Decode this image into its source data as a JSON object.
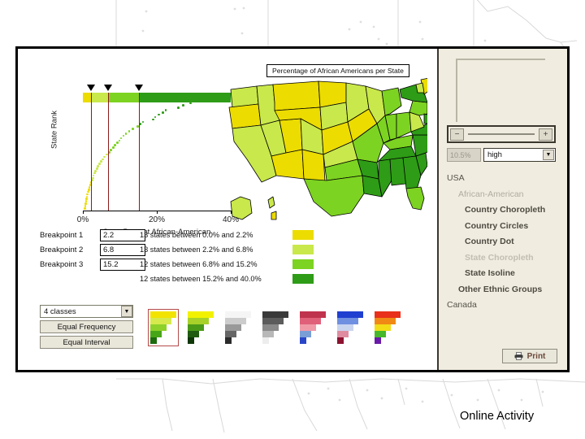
{
  "slide": {
    "caption": "Online Activity"
  },
  "chart_panel": {
    "yaxis_title": "State Rank",
    "xaxis_title": "State Percent African-American",
    "xticks": [
      "0%",
      "20%",
      "40%"
    ],
    "map_title": "Percentage of African Americans per State"
  },
  "chart_data": {
    "type": "scatter",
    "title": "Percentage of African Americans per State",
    "xlabel": "State Percent African-American",
    "ylabel": "State Rank",
    "xlim": [
      0,
      40
    ],
    "ylim": [
      50,
      0
    ],
    "xticks": [
      0,
      20,
      40
    ],
    "xtick_labels": [
      "0%",
      "20%",
      "40%"
    ],
    "grid": false,
    "legend_position": "right",
    "breakpoints": [
      2.2,
      6.8,
      15.2
    ],
    "class_colors": [
      "#ecdc00",
      "#c9e84b",
      "#7dd321",
      "#2e9c16"
    ],
    "class_counts": [
      13,
      13,
      12,
      12
    ],
    "class_ranges": [
      [
        0.0,
        2.2
      ],
      [
        2.2,
        6.8
      ],
      [
        6.8,
        15.2
      ],
      [
        15.2,
        40.0
      ]
    ],
    "points": [
      {
        "x": 36.8,
        "y": 1
      },
      {
        "x": 32.2,
        "y": 2
      },
      {
        "x": 31.1,
        "y": 3
      },
      {
        "x": 29.9,
        "y": 4
      },
      {
        "x": 28.8,
        "y": 5
      },
      {
        "x": 26.8,
        "y": 6
      },
      {
        "x": 25.6,
        "y": 7
      },
      {
        "x": 22.1,
        "y": 8
      },
      {
        "x": 21.4,
        "y": 9
      },
      {
        "x": 20.2,
        "y": 10
      },
      {
        "x": 19.3,
        "y": 11
      },
      {
        "x": 18.7,
        "y": 12
      },
      {
        "x": 16.0,
        "y": 13
      },
      {
        "x": 15.2,
        "y": 14
      },
      {
        "x": 14.6,
        "y": 15
      },
      {
        "x": 13.2,
        "y": 16
      },
      {
        "x": 12.2,
        "y": 17
      },
      {
        "x": 11.4,
        "y": 18
      },
      {
        "x": 10.7,
        "y": 19
      },
      {
        "x": 10.0,
        "y": 20
      },
      {
        "x": 9.6,
        "y": 21
      },
      {
        "x": 9.1,
        "y": 22
      },
      {
        "x": 8.4,
        "y": 23
      },
      {
        "x": 7.9,
        "y": 24
      },
      {
        "x": 7.3,
        "y": 25
      },
      {
        "x": 6.8,
        "y": 26
      },
      {
        "x": 6.2,
        "y": 27
      },
      {
        "x": 5.6,
        "y": 28
      },
      {
        "x": 5.1,
        "y": 29
      },
      {
        "x": 4.7,
        "y": 30
      },
      {
        "x": 4.2,
        "y": 31
      },
      {
        "x": 3.8,
        "y": 32
      },
      {
        "x": 3.5,
        "y": 33
      },
      {
        "x": 3.1,
        "y": 34
      },
      {
        "x": 2.9,
        "y": 35
      },
      {
        "x": 2.6,
        "y": 36
      },
      {
        "x": 2.4,
        "y": 37
      },
      {
        "x": 2.2,
        "y": 38
      },
      {
        "x": 1.9,
        "y": 39
      },
      {
        "x": 1.7,
        "y": 40
      },
      {
        "x": 1.5,
        "y": 41
      },
      {
        "x": 1.3,
        "y": 42
      },
      {
        "x": 1.1,
        "y": 43
      },
      {
        "x": 0.9,
        "y": 44
      },
      {
        "x": 0.8,
        "y": 45
      },
      {
        "x": 0.7,
        "y": 46
      },
      {
        "x": 0.6,
        "y": 47
      },
      {
        "x": 0.5,
        "y": 48
      },
      {
        "x": 0.4,
        "y": 49
      },
      {
        "x": 0.3,
        "y": 50
      }
    ]
  },
  "breakpoints": [
    {
      "label": "Breakpoint 1",
      "value": "2.2"
    },
    {
      "label": "Breakpoint 2",
      "value": "6.8"
    },
    {
      "label": "Breakpoint 3",
      "value": "15.2"
    }
  ],
  "legend": [
    {
      "text": "13 states between 0.0% and 2.2%",
      "color": "#ecdc00"
    },
    {
      "text": "13 states between 2.2% and 6.8%",
      "color": "#c9e84b"
    },
    {
      "text": "12 states between 6.8% and 15.2%",
      "color": "#7dd321"
    },
    {
      "text": "12 states between 15.2% and 40.0%",
      "color": "#2e9c16"
    }
  ],
  "class_controls": {
    "classes_value": "4 classes",
    "dropdown_icon": "chevron-down-icon",
    "equal_frequency_label": "Equal Frequency",
    "equal_interval_label": "Equal Interval"
  },
  "ramp_picker": {
    "selected_index": 0,
    "ramps": [
      {
        "name": "yellow-green",
        "colors": [
          "#f2e300",
          "#d6ea4e",
          "#8ed12a",
          "#47a618",
          "#1d6b0d"
        ]
      },
      {
        "name": "green-dark",
        "colors": [
          "#f2f200",
          "#a8d12a",
          "#4a9a18",
          "#1f5c10",
          "#0f3708"
        ]
      },
      {
        "name": "gray-light",
        "colors": [
          "#f5f5f5",
          "#cccccc",
          "#999999",
          "#666666",
          "#2b2b2b"
        ]
      },
      {
        "name": "gray-dark",
        "colors": [
          "#3a3a3a",
          "#5c5c5c",
          "#8a8a8a",
          "#b8b8b8",
          "#ededed"
        ]
      },
      {
        "name": "red-blue",
        "colors": [
          "#c0334d",
          "#e0607a",
          "#f09aa8",
          "#7a9fd6",
          "#2a46c8"
        ]
      },
      {
        "name": "blue-red",
        "colors": [
          "#1f3fd0",
          "#6f8fe0",
          "#c9d4ef",
          "#e08ca0",
          "#8c1230"
        ]
      },
      {
        "name": "rainbow",
        "colors": [
          "#e8301a",
          "#f08a14",
          "#f2dd16",
          "#46b82a",
          "#6a1aa8"
        ]
      }
    ]
  },
  "side_panel": {
    "zoom_out_label": "−",
    "zoom_in_label": "+",
    "zoom_value": "10.5%",
    "quality_value": "high",
    "quality_icon": "chevron-down-icon",
    "nav": [
      {
        "label": "USA",
        "level": 0,
        "disabled": false
      },
      {
        "label": "African-American",
        "level": 1,
        "disabled": true
      },
      {
        "label": "Country Choropleth",
        "level": 2,
        "disabled": false
      },
      {
        "label": "Country Circles",
        "level": 2,
        "disabled": false
      },
      {
        "label": "Country Dot",
        "level": 2,
        "disabled": false
      },
      {
        "label": "State Choropleth",
        "level": 2,
        "disabled": true
      },
      {
        "label": "State Isoline",
        "level": 2,
        "disabled": false
      },
      {
        "label": "Other Ethnic Groups",
        "level": 1,
        "disabled": false
      },
      {
        "label": "Canada",
        "level": 0,
        "disabled": false
      }
    ],
    "print_label": "Print",
    "print_icon": "printer-icon"
  }
}
